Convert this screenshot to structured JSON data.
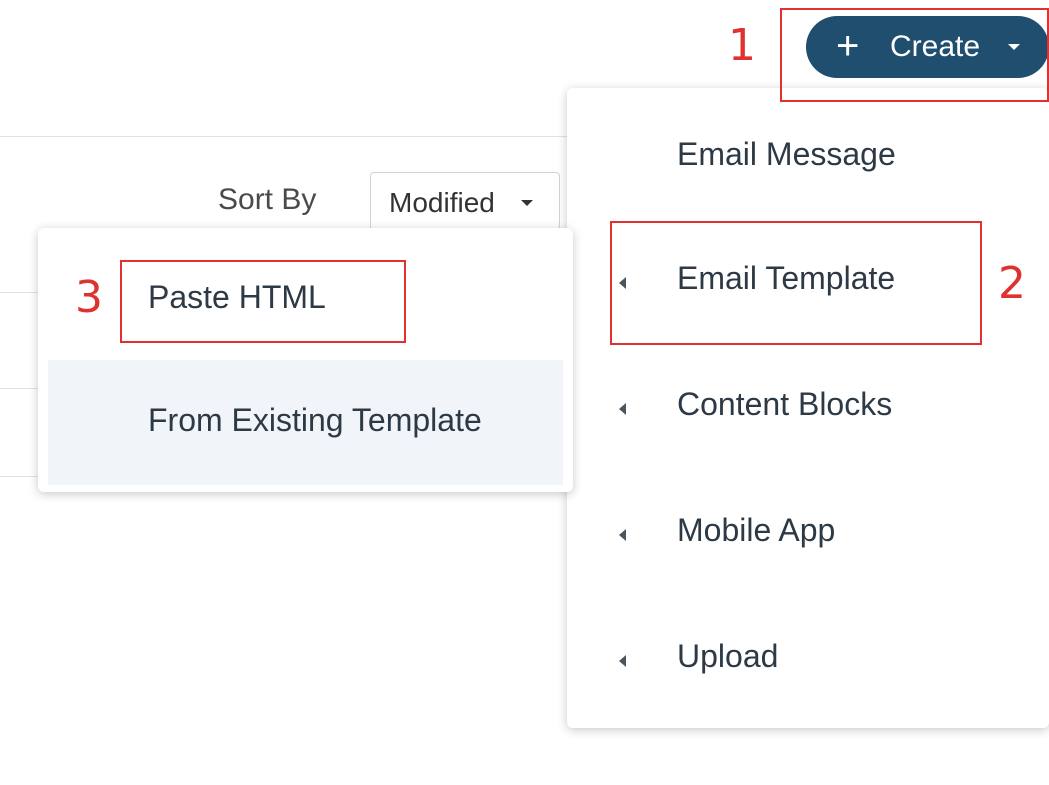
{
  "sort": {
    "label": "Sort By",
    "selected": "Modified"
  },
  "create_button": {
    "plus": "+",
    "label": "Create"
  },
  "create_menu": {
    "items": [
      {
        "label": "Email Message",
        "has_submenu": false
      },
      {
        "label": "Email Template",
        "has_submenu": true
      },
      {
        "label": "Content Blocks",
        "has_submenu": true
      },
      {
        "label": "Mobile App",
        "has_submenu": true
      },
      {
        "label": "Upload",
        "has_submenu": true
      }
    ]
  },
  "sub_menu": {
    "items": [
      {
        "label": "Paste HTML"
      },
      {
        "label": "From Existing Template"
      }
    ]
  },
  "annotations": {
    "step1": "1",
    "step2": "2",
    "step3": "3"
  },
  "colors": {
    "create_button_bg": "#1f4e6f",
    "annotation_red": "#e03131",
    "hover_bg": "#f1f4f8"
  }
}
